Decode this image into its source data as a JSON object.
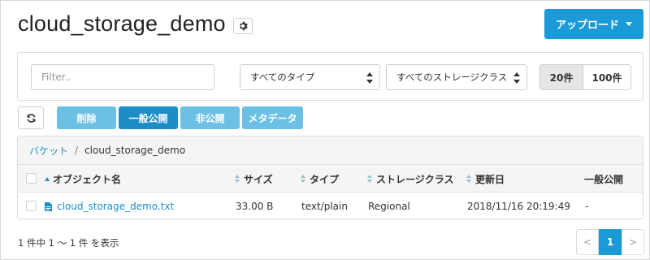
{
  "header": {
    "title": "cloud_storage_demo",
    "upload_label": "アップロード"
  },
  "filters": {
    "search_placeholder": "Filter..",
    "type_select": "すべてのタイプ",
    "storage_class_select": "すべてのストレージクラス",
    "page_size_options": [
      "20件",
      "100件"
    ],
    "page_size_selected": "20件"
  },
  "actions": {
    "delete": "削除",
    "make_public": "一般公開",
    "make_private": "非公開",
    "metadata": "メタデータ"
  },
  "breadcrumb": {
    "root": "バケット",
    "separator": "/",
    "current": "cloud_storage_demo"
  },
  "table": {
    "columns": [
      "オブジェクト名",
      "サイズ",
      "タイプ",
      "ストレージクラス",
      "更新日",
      "一般公開"
    ],
    "rows": [
      {
        "name": "cloud_storage_demo.txt",
        "size": "33.00 B",
        "type": "text/plain",
        "storage_class": "Regional",
        "updated": "2018/11/16 20:19:49",
        "public": "-"
      }
    ]
  },
  "footer": {
    "count_text": "1 件中 1 〜 1 件 を表示",
    "pager": {
      "prev": "<",
      "current": "1",
      "next": ">"
    }
  },
  "colors": {
    "primary": "#1a9ad6",
    "primary_dark": "#1d8dc6",
    "primary_light": "#6cc0e3",
    "link": "#1a8fd0"
  }
}
